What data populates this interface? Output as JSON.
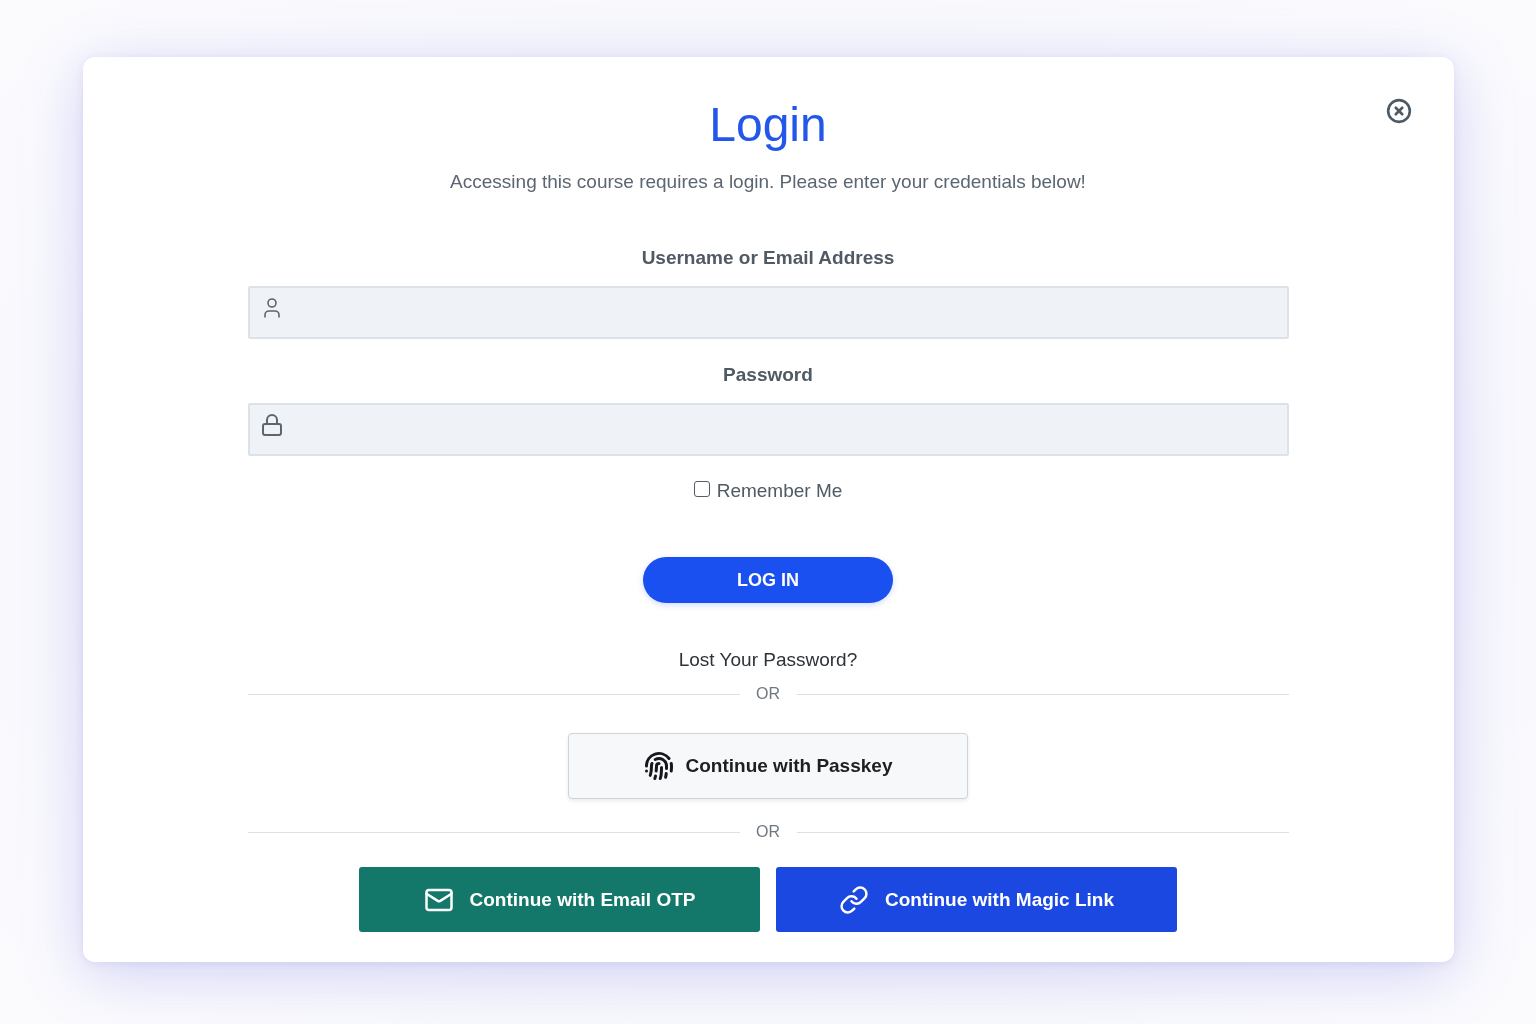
{
  "dialog": {
    "title": "Login",
    "subtitle": "Accessing this course requires a login. Please enter your credentials below!"
  },
  "fields": [
    {
      "label": "Username or Email Address",
      "kind": "username"
    },
    {
      "label": "Password",
      "kind": "password"
    }
  ],
  "remember_me": {
    "label": "Remember Me",
    "checked": false
  },
  "login_button": "LOG IN",
  "lost_password_link": "Lost Your Password?",
  "first_divider": "OR",
  "passkey_button": "Continue with Passkey",
  "second_divider": "OR",
  "alt_buttons": [
    {
      "label": "Continue with Email OTP",
      "kind": "email",
      "color": "#13786a"
    },
    {
      "label": "Continue with Magic Link",
      "kind": "link",
      "color": "#1b48e0"
    }
  ]
}
